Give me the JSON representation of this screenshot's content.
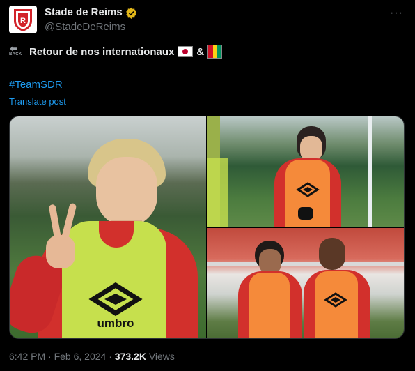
{
  "tweet": {
    "display_name": "Stade de Reims",
    "handle": "@StadeDeReims",
    "back_label": "BACK",
    "text_main": "Retour de nos internationaux",
    "text_amp": "&",
    "hashtag": "#TeamSDR",
    "translate_label": "Translate post",
    "time": "6:42 PM",
    "date": "Feb 6, 2024",
    "separator": "·",
    "views_count": "373.2K",
    "views_label": "Views",
    "more_label": "···"
  },
  "colors": {
    "link": "#1d9bf0",
    "verified": "#e2b719",
    "secondary_text": "#71767b",
    "bib_yellow": "#c6e04d",
    "bib_orange": "#f58a3a",
    "shirt_red": "#d2302c"
  },
  "media": {
    "count": 3,
    "bib_brand": "umbro"
  },
  "icons": {
    "verified": "verified-badge-icon",
    "more": "more-options-icon",
    "back": "back-arrow-icon"
  }
}
